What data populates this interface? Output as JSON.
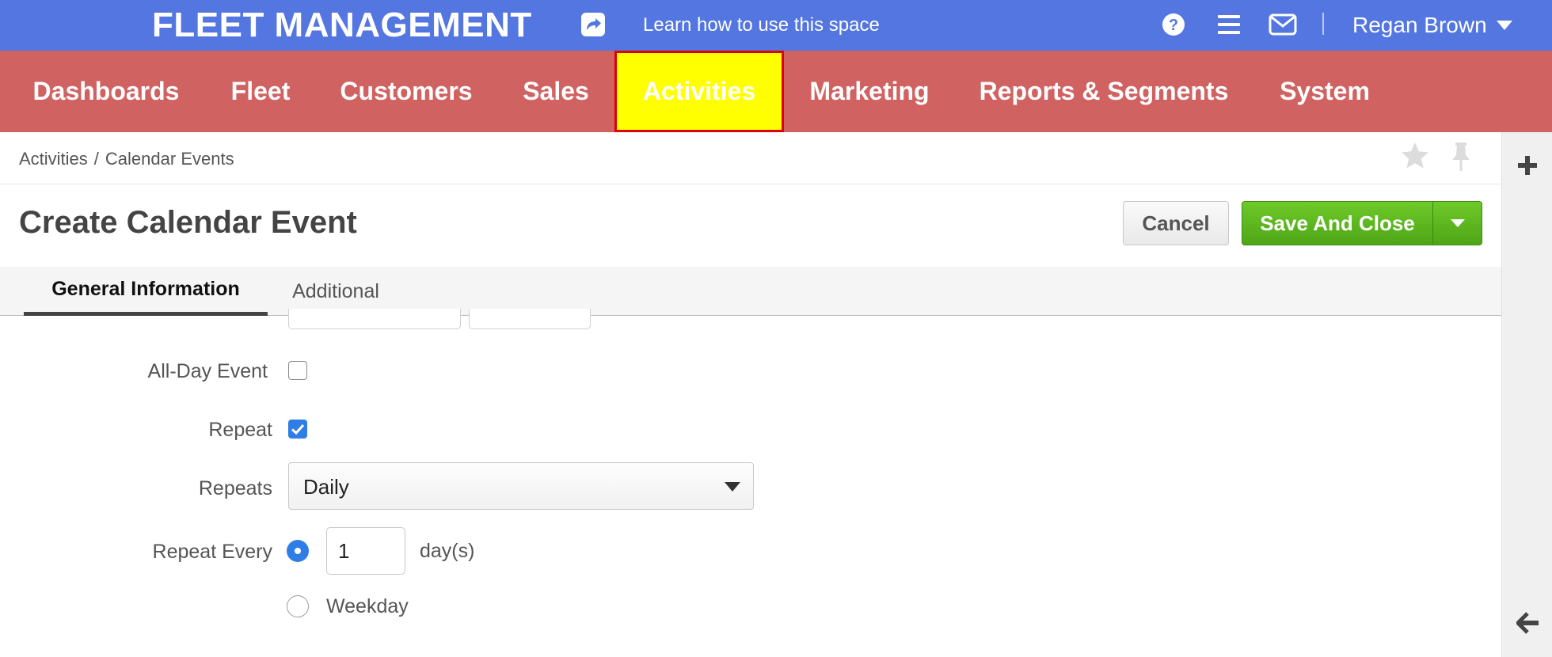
{
  "topbar": {
    "brand": "FLEET MANAGEMENT",
    "learn_link": "Learn how to use this space",
    "user_name": "Regan Brown",
    "icons": [
      "share-icon",
      "help-icon",
      "menu-icon",
      "mail-icon",
      "caret-down-icon"
    ]
  },
  "nav": {
    "items": [
      {
        "label": "Dashboards"
      },
      {
        "label": "Fleet"
      },
      {
        "label": "Customers"
      },
      {
        "label": "Sales"
      },
      {
        "label": "Activities",
        "active": true
      },
      {
        "label": "Marketing"
      },
      {
        "label": "Reports & Segments"
      },
      {
        "label": "System"
      }
    ]
  },
  "breadcrumb": {
    "items": [
      "Activities",
      "Calendar Events"
    ],
    "separator": "/"
  },
  "page": {
    "title": "Create Calendar Event",
    "cancel_label": "Cancel",
    "save_label": "Save And Close"
  },
  "tabs": {
    "items": [
      {
        "label": "General Information",
        "active": true
      },
      {
        "label": "Additional",
        "active": false
      }
    ]
  },
  "form": {
    "all_day_label": "All-Day Event",
    "all_day_checked": false,
    "repeat_label": "Repeat",
    "repeat_checked": true,
    "repeats_label": "Repeats",
    "repeats_value": "Daily",
    "repeat_every_label": "Repeat Every",
    "repeat_every_value": "1",
    "repeat_every_unit": "day(s)",
    "weekday_label": "Weekday",
    "selected_option": "every"
  },
  "colors": {
    "topbar": "#5376e0",
    "nav": "#d06262",
    "nav_active_bg": "#ffff00",
    "nav_active_border": "#e00000",
    "primary_button": "#5cb41f",
    "checkbox_accent": "#2f7ee6"
  }
}
